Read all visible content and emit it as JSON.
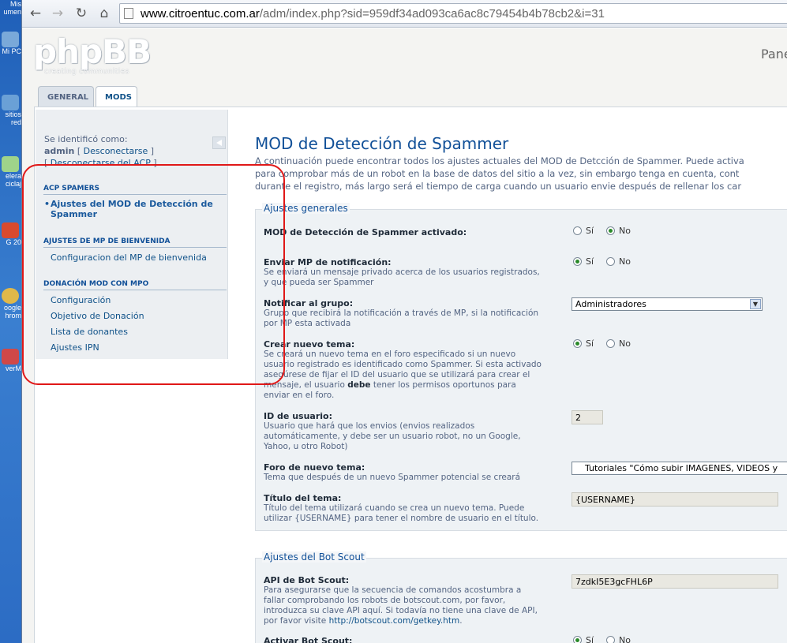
{
  "desktop": {
    "icons": [
      {
        "label": "Mis\numen",
        "color": "#e8d27a"
      },
      {
        "label": "Mi PC",
        "color": "#7aa9d9"
      },
      {
        "label": "sitios\nred",
        "color": "#6aa0d6"
      },
      {
        "label": "elera\nciclaj",
        "color": "#9fd38a"
      },
      {
        "label": "G 20",
        "color": "#d84a2e"
      },
      {
        "label": "oogle\nhrom",
        "color": "#e0b84a"
      },
      {
        "label": "verM",
        "color": "#d04848"
      }
    ]
  },
  "browser": {
    "url_host": "www.citroentuc.com.ar",
    "url_path": "/adm/index.php?sid=959df34ad093ca6ac8c79454b4b78cb2&i=31"
  },
  "header": {
    "logo": "phpBB",
    "logo_sub": "creating   communities",
    "panel_label": "Pane"
  },
  "tabs": [
    {
      "label": "GENERAL"
    },
    {
      "label": "MODS"
    }
  ],
  "sidebar": {
    "identified_as": "Se identificó como:",
    "user": "admin",
    "logout": "Desconectarse",
    "logout_acp": "Desconectarse del ACP",
    "sections": [
      {
        "title": "ACP SPAMERS",
        "items": [
          "Ajustes del MOD de Detección de",
          "Spammer"
        ]
      },
      {
        "title": "AJUSTES DE MP DE BIENVENIDA",
        "items": [
          "Configuracion del MP de bienvenida"
        ]
      },
      {
        "title": "DONACIÓN MOD CON MPO",
        "items": [
          "Configuración",
          "Objetivo de Donación",
          "Lista de donantes",
          "Ajustes IPN"
        ]
      }
    ]
  },
  "main": {
    "title": "MOD de Detección de Spammer",
    "intro": [
      "A continuación puede encontrar todos los ajustes actuales del MOD de Detcción de Spammer. Puede activa",
      "para comprobar más de un robot en la base de datos del sitio a la vez, sin embargo tenga en cuenta, cont",
      "durante el registro, más largo será el tiempo de carga cuando un usuario envie después de rellenar los car"
    ],
    "general": {
      "legend": "Ajustes generales",
      "activated": {
        "label": "MOD de Detección de Spammer activado:",
        "value": "No"
      },
      "send_pm": {
        "label": "Enviar MP de notificación:",
        "desc": [
          "Se enviará un mensaje privado acerca de los usuarios registrados,",
          "y que pueda ser Spammer"
        ],
        "value": "Sí"
      },
      "notify_group": {
        "label": "Notificar al grupo:",
        "desc": [
          "Grupo que recibirá la notificación a través de MP, si la notificación",
          "por MP esta activada"
        ],
        "value": "Administradores"
      },
      "new_topic": {
        "label": "Crear nuevo tema:",
        "desc": [
          "Se creará un nuevo tema en el foro especificado si un nuevo",
          "usuario registrado es identificado como Spammer. Si esta activado",
          "asegúrese de fijar el ID del usuario que se utilizará para crear el",
          "mensaje, el usuario",
          "debe",
          "tener los permisos oportunos para",
          "enviar en el foro."
        ],
        "value": "Sí"
      },
      "user_id": {
        "label": "ID de usuario:",
        "desc": [
          "Usuario que hará que los envios (envios realizados",
          "automáticamente, y debe ser un usuario robot, no un Google,",
          "Yahoo, u otro Robot)"
        ],
        "value": "2"
      },
      "topic_forum": {
        "label": "Foro de nuevo tema:",
        "desc": [
          "Tema que después de un nuevo Spammer potencial se creará"
        ],
        "value": "Tutoriales \"Cómo subir IMAGENES, VIDEOS y"
      },
      "topic_title": {
        "label": "Título del tema:",
        "desc": [
          "Título del tema utilizará cuando se crea un nuevo tema. Puede",
          "utilizar {USERNAME} para tener el nombre de usuario en el título."
        ],
        "value": "{USERNAME}"
      }
    },
    "botscout": {
      "legend": "Ajustes del Bot Scout",
      "api": {
        "label": "API de Bot Scout:",
        "desc": [
          "Para asegurarse que la secuencia de comandos acostumbra a",
          "fallar comprobando los robots de botscout.com, por favor,",
          "introduzca su clave API aquí. Si todavía no tiene una clave de API,",
          "por favor visite",
          "http://botscout.com/getkey.htm",
          "."
        ],
        "value": "7zdkI5E3gcFHL6P"
      },
      "activate": {
        "label": "Activar Bot Scout:",
        "value": "Sí"
      }
    },
    "radio_yes": "Sí",
    "radio_no": "No"
  }
}
